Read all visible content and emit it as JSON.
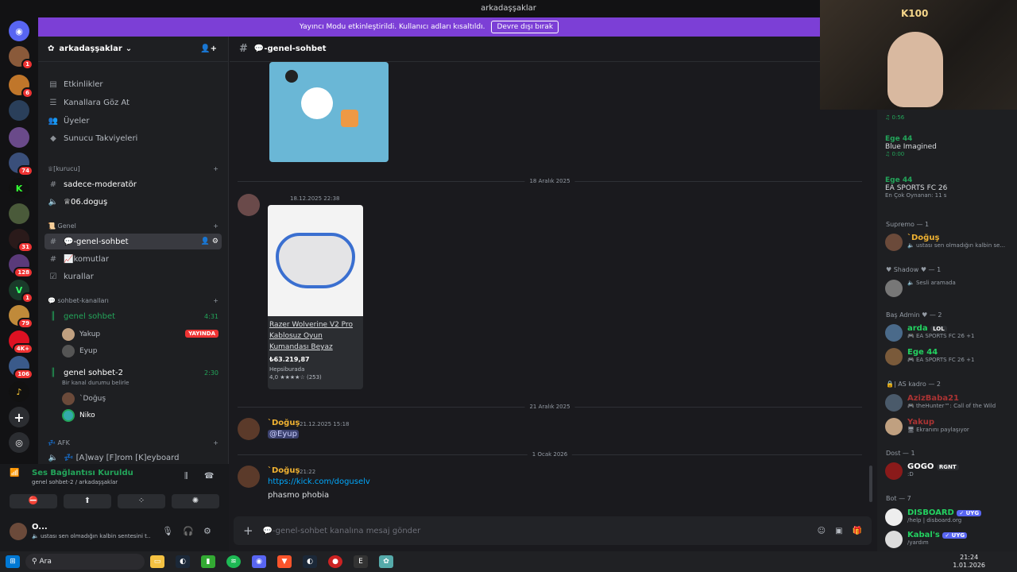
{
  "window": {
    "title": "arkadaşşaklar"
  },
  "banner": {
    "text": "Yayıncı Modu etkinleştirildi. Kullanıcı adları kısaltıldı.",
    "button": "Devre dışı bırak"
  },
  "servers": {
    "badges": [
      "1",
      "6",
      "74",
      "31",
      "128",
      "1",
      "79",
      "4K+",
      "106"
    ]
  },
  "sidebar": {
    "server_name": "arkadaşşaklar",
    "top_items": [
      "Etkinlikler",
      "Kanallara Göz At",
      "Üyeler",
      "Sunucu Takviyeleri"
    ],
    "cat_kurucu": "♕[kurucu]",
    "ch_moderator": "sadece-moderatör",
    "ch_dogus": "♕06.doguş",
    "cat_genel": "📜 Genel",
    "ch_genel": "💬-genel-sohbet",
    "ch_komutlar": "📈komutlar",
    "ch_kurallar": "kurallar",
    "cat_sohbet": "💬 sohbet-kanalları",
    "vc1": {
      "name": "genel sohbet",
      "time": "4:31",
      "users": [
        {
          "name": "Yakup",
          "live": "YAYINDA"
        },
        {
          "name": "Eyup"
        }
      ]
    },
    "vc2": {
      "name": "genel sohbet-2",
      "time": "2:30",
      "status": "Bir kanal durumu belirle",
      "users": [
        {
          "name": "`Doğuş"
        },
        {
          "name": "Niko"
        }
      ]
    },
    "cat_afk": "💤 AFK",
    "ch_afk": "💤 [A]way [F]rom [K]eyboard"
  },
  "voice_panel": {
    "title": "Ses Bağlantısı Kuruldu",
    "sub": "genel sohbet-2 / arkadaşşaklar"
  },
  "user_panel": {
    "name": "O...",
    "status": "🔈 ustası sen olmadığın kalbin sentesini t..."
  },
  "chat": {
    "channel": "💬-genel-sohbet",
    "date1": "18 Aralık 2025",
    "msg1_time": "18.12.2025 22:38",
    "embed": {
      "title": "Razer Wolverine V2 Pro Kablosuz Oyun Kumandası Beyaz",
      "price": "₺63.219,87",
      "store": "Hepsiburada",
      "rating": "4,0 ★★★★☆ (253)"
    },
    "date2": "21 Aralık 2025",
    "msg2": {
      "name": "`Doğuş",
      "time": "21.12.2025 15:18",
      "text": "@Eyup"
    },
    "date3": "1 Ocak 2026",
    "msg3": {
      "name": "`Doğuş",
      "time": "21:22",
      "link": "https://kick.com/doguselv",
      "text": "phasmo phobia"
    },
    "placeholder": "💬-genel-sohbet kanalına mesaj gönder"
  },
  "members": {
    "top": [
      {
        "name": "",
        "stat": "♫ 0:56"
      },
      {
        "name": "Ege 44",
        "song": "Blue Imagined",
        "stat": "♫ 0:00"
      },
      {
        "name": "Ege 44",
        "song": "EA SPORTS FC 26",
        "stat": "En Çok Oynanan: 11 s"
      }
    ],
    "g1": "Supremo — 1",
    "g1_m": {
      "name": "`Doğuş",
      "stat": "🔈 ustası sen olmadığın kalbin se..."
    },
    "g2": "♥ Shadow ♥ — 1",
    "g2_m": {
      "name": "",
      "stat": "🔈 Sesli aramada"
    },
    "g3": "Baş Admin ♥ — 2",
    "g3_m": [
      {
        "name": "arda",
        "tag": "LOL",
        "stat": "🎮 EA SPORTS FC 26 +1"
      },
      {
        "name": "Ege 44",
        "stat": "🎮 EA SPORTS FC 26 +1"
      }
    ],
    "g4": "🔒| AS kadro — 2",
    "g4_m": [
      {
        "name": "AzizBaba21",
        "stat": "🎮 theHunter™: Call of the Wild"
      },
      {
        "name": "Yakup",
        "stat": "🖥 Ekranını paylaşıyor"
      }
    ],
    "g5": "Dost — 1",
    "g5_m": {
      "name": "GOGO",
      "tag": "RGNT",
      "stat": ":D"
    },
    "g6": "Bot — 7",
    "g6_m": [
      {
        "name": "DISBOARD",
        "tag": "✓ UYG",
        "stat": "/help | disboard.org"
      },
      {
        "name": "Kabal's",
        "tag": "✓ UYG",
        "stat": "/yardım"
      }
    ]
  },
  "taskbar": {
    "search": "Ara",
    "time": "21:24",
    "date": "1.01.2026"
  },
  "colors": {
    "accent": "#7c3fd6",
    "green": "#23a55a",
    "red": "#e33",
    "link": "#00a8fc",
    "gold": "#f0b232"
  }
}
